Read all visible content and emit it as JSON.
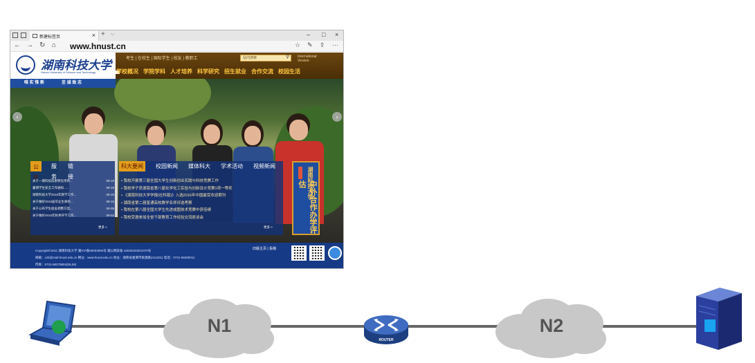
{
  "browser": {
    "tab_title": "新建标签页",
    "tab_close": "×",
    "new_tab": "+",
    "tab_menu": "⌵",
    "win_minimize": "–",
    "win_maximize": "□",
    "win_close": "×",
    "back": "←",
    "forward": "→",
    "refresh": "↻",
    "home": "⌂",
    "url": "www.hnust.cn",
    "tool_favorite": "☆",
    "tool_notes": "✎",
    "tool_share": "⇪",
    "tool_more": "···"
  },
  "site": {
    "logo_text": "湖南科技大学",
    "logo_sub": "Hunan University of Science and Technology",
    "quicklinks": "考生 | 在校生 | 国际学生 | 校友 | 教职工",
    "search_placeholder": "站内搜索",
    "intl_line1": "International",
    "intl_line2": "Version",
    "nav": [
      "学校概况",
      "学院学科",
      "人才培养",
      "科学研究",
      "招生就业",
      "合作交流",
      "校园生活"
    ],
    "motto": [
      "唯 实 惟 新",
      "至 诚 致 志"
    ]
  },
  "notices": {
    "tabs": [
      "公告",
      "服务",
      "链接"
    ],
    "items": [
      {
        "title": "关于一期科技成果转化项目...",
        "date": "08-19"
      },
      {
        "title": "暑期学生安全工作通知......",
        "date": "08-18"
      },
      {
        "title": "湖南科技大学2016年教学工作...",
        "date": "08-15"
      },
      {
        "title": "关于做好2016届毕业生离校...",
        "date": "08-15"
      },
      {
        "title": "关于公布学生宿舍调整方案...",
        "date": "08-05"
      },
      {
        "title": "关于做好2016年秋季开学工作...",
        "date": "08-02"
      }
    ],
    "more": "更多 >"
  },
  "news": {
    "tabs": [
      "科大要闻",
      "校园新闻",
      "媒体科大",
      "学术活动",
      "视频新闻"
    ],
    "items": [
      "我校开展第三届全国大学生创新创业实践与科技竞赛工作",
      "我校学子获湖南省第八届化学化工实验与创新设计竞赛1项一等奖",
      "《湖南科技大学学报(社科版)》入选2016年中国最受欢迎期刊",
      "湖南省第二届普通高校教学名师评选考察",
      "我校在第八届全国大学生先进成图技术竞赛中获佳绩",
      "我校受邀参加全省干部教育工作经验交流座谈会"
    ],
    "more": "更多 >"
  },
  "feature": {
    "title_small": "湖南科技大学",
    "title_big": "中外合作办学评估"
  },
  "footer": {
    "line1": "Copyright©2011 湖南科技大学 湘ICP备05003890号 湘公网安备 43030202001070号",
    "line2": "邮箱：xzb@mail.hnust.edu.cn 网址：www.hnust.edu.cn 地址：湖南省湘潭市桃源路(411201) 电话：0731-58290011",
    "line3": "传真：0731-58279804(05,06)",
    "links": "旧版主页 | 投稿"
  },
  "diagram": {
    "cloud1": "N1",
    "cloud2": "N2",
    "router_label": "ROUTER",
    "colors": {
      "link": "#666666",
      "cloud": "#c8c8c8",
      "router": "#2e56a6",
      "server": "#2a3f9e",
      "laptop": "#2f62b8"
    }
  }
}
